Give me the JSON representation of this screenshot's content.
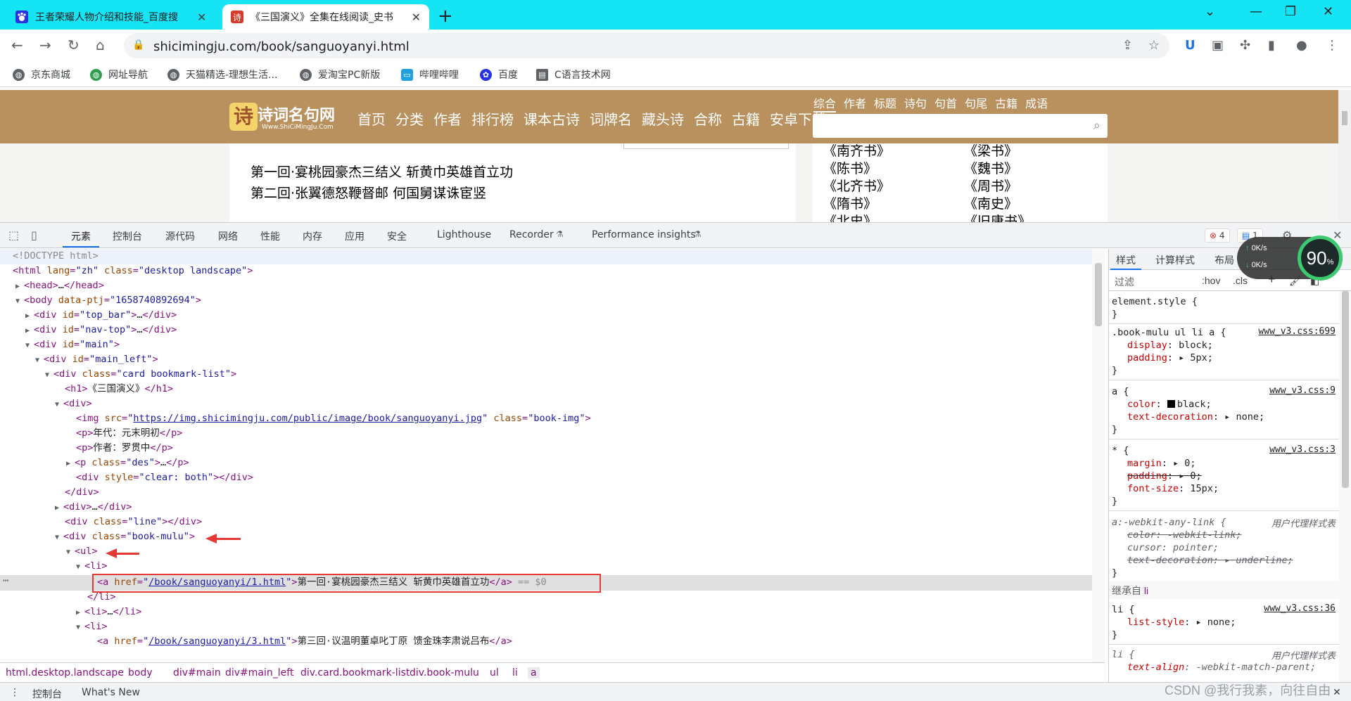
{
  "tabs": [
    {
      "title": "王者荣耀人物介绍和技能_百度搜",
      "favicon": "baidu-paw-icon"
    },
    {
      "title": "《三国演义》全集在线阅读_史书",
      "favicon": "shicimingju-icon"
    }
  ],
  "address": {
    "url": "shicimingju.com/book/sanguoyanyi.html"
  },
  "bookmarks": [
    "京东商城",
    "网址导航",
    "天猫精选-理想生活...",
    "爱淘宝PC新版",
    "哔哩哔哩",
    "百度",
    "C语言技术网"
  ],
  "site": {
    "logo_text": "诗词名句网",
    "logo_sub": "Www.ShiCiMingJu.Com",
    "logo_mark": "诗",
    "nav": [
      "首页",
      "分类",
      "作者",
      "排行榜",
      "课本古诗",
      "词牌名",
      "藏头诗",
      "合称",
      "古籍",
      "安卓下载"
    ],
    "search_tabs": [
      "综合",
      "作者",
      "标题",
      "诗句",
      "句首",
      "句尾",
      "古籍",
      "成语"
    ],
    "chapters": [
      "第一回·宴桃园豪杰三结义 斩黄巾英雄首立功",
      "第二回·张翼德怒鞭督邮 何国舅谋诛宦竖"
    ],
    "books_left": [
      "《南齐书》",
      "《陈书》",
      "《北齐书》",
      "《隋书》",
      "《北史》"
    ],
    "books_right": [
      "《梁书》",
      "《魏书》",
      "《周书》",
      "《南史》",
      "《旧唐书》"
    ]
  },
  "devtools": {
    "tabs": [
      "元素",
      "控制台",
      "源代码",
      "网络",
      "性能",
      "内存",
      "应用",
      "安全",
      "Lighthouse",
      "Recorder",
      "Performance insights"
    ],
    "errors": "4",
    "messages": "1",
    "elements": {
      "doctype": "<!DOCTYPE html>",
      "body_ptj": "1658740892694",
      "h1_text": "《三国演义》",
      "img_src": "https://img.shicimingju.com/public/image/book/sanguoyanyi.jpg",
      "p_era": "年代：元末明初",
      "p_author": "作者：罗贯中",
      "a1_href": "/book/sanguoyanyi/1.html",
      "a1_text": "第一回·宴桃园豪杰三结义  斩黄巾英雄首立功",
      "a3_href": "/book/sanguoyanyi/3.html",
      "a3_text": "第三回·议温明董卓叱丁原  馈金珠李肃说吕布",
      "selected_marker": "== $0"
    },
    "breadcrumbs": [
      "html.desktop.landscape",
      "body",
      "div#main",
      "div#main_left",
      "div.card.bookmark-list",
      "div.book-mulu",
      "ul",
      "li",
      "a"
    ],
    "drawer": [
      "控制台",
      "What's New"
    ],
    "styles": {
      "tabs": [
        "样式",
        "计算样式",
        "布局"
      ],
      "filter_placeholder": "过滤",
      "hov": ":hov",
      "cls": ".cls",
      "inherited_label": "继承自",
      "inherited_tag": "li",
      "ua_label": "用户代理样式表",
      "sources": {
        "mulu": "www_v3.css:699",
        "a": "www_v3.css:9",
        "star": "www_v3.css:3",
        "li": "www_v3.css:36"
      }
    },
    "speed": {
      "percent": "90",
      "unit": "%",
      "up": "0K/s",
      "down": "0K/s"
    }
  },
  "watermark": "CSDN @我行我素，向往自由"
}
